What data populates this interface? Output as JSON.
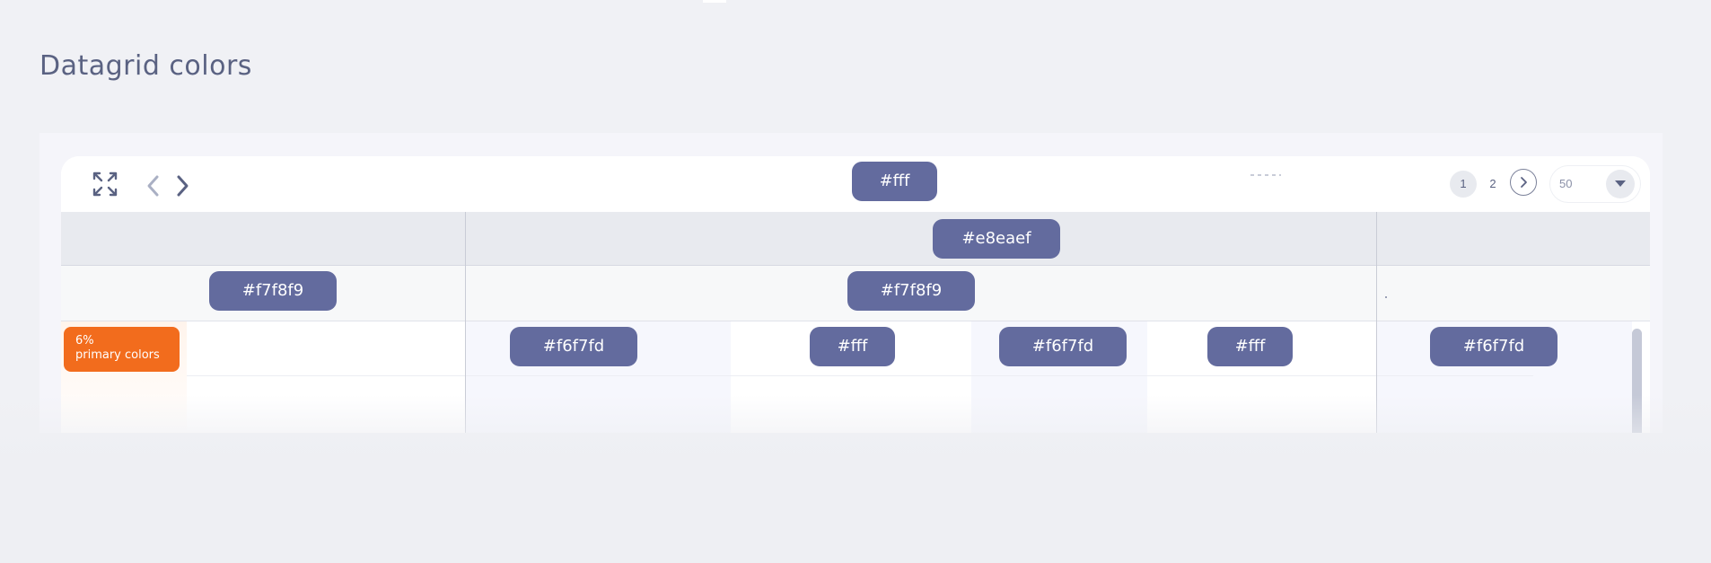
{
  "page": {
    "title": "Datagrid colors"
  },
  "toolbar": {
    "chip": "#fff",
    "pagination": {
      "pages": [
        "1",
        "2"
      ],
      "page_size": "50"
    }
  },
  "header_row_1": {
    "chip": "#e8eaef"
  },
  "header_row_2": {
    "chips": [
      "#f7f8f9",
      "#f7f8f9"
    ]
  },
  "body": {
    "badge": {
      "percent": "6%",
      "label": "primary colors"
    },
    "chips": [
      "#f6f7fd",
      "#fff",
      "#f6f7fd",
      "#fff",
      "#f6f7fd"
    ]
  },
  "colors": {
    "chip_bg": "#636b9e",
    "badge_bg": "#f26c1d",
    "page_bg": "#f0f1f5",
    "header_1_bg": "#e8eaef",
    "header_2_bg": "#f7f8f9",
    "stripe_bg": "#f6f7fd",
    "cell_bg": "#fff"
  }
}
